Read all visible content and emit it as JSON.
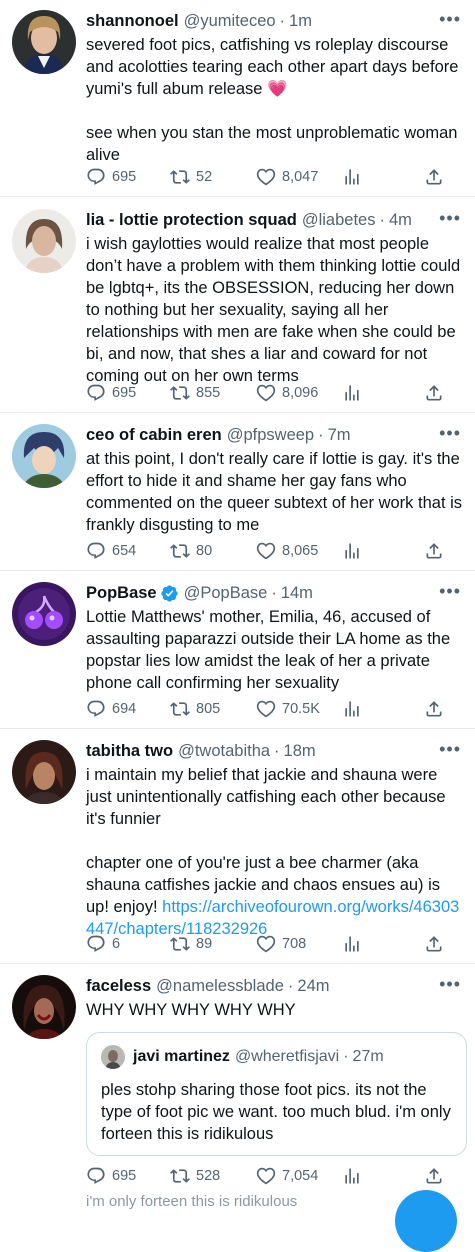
{
  "colors": {
    "accent": "#1d9bf0",
    "muted": "#536471",
    "divider": "#e6ecf0"
  },
  "tweets": [
    {
      "name": "shannonoel",
      "handle": "@yumiteceo",
      "time": "1m",
      "text": "severed foot pics, catfishing vs roleplay discourse and acolotties tearing each other apart days before yumi's full abum release 💗\n\nsee when you stan the most unproblematic woman alive",
      "replies": "695",
      "retweets": "52",
      "likes": "8,047"
    },
    {
      "name": "lia - lottie protection squad",
      "handle": "@liabetes",
      "time": "4m",
      "text": "i wish gaylotties would realize that most people don’t have a problem with them thinking lottie could be lgbtq+, its the OBSESSION, reducing her down to nothing but her sexuality, saying all her relationships with men are fake when she could be bi, and now, that shes a liar and coward for not coming out on her own terms",
      "replies": "695",
      "retweets": "855",
      "likes": "8,096"
    },
    {
      "name": "ceo of cabin eren",
      "handle": "@pfpsweep",
      "time": "7m",
      "text": "at this point, I don't really care if lottie is gay. it's the effort to hide it and shame her gay fans who commented on the queer subtext of her work that is frankly disgusting to me",
      "replies": "654",
      "retweets": "80",
      "likes": "8,065"
    },
    {
      "name": "PopBase",
      "handle": "@PopBase",
      "time": "14m",
      "verified": true,
      "text": "Lottie Matthews' mother, Emilia, 46, accused of assaulting paparazzi outside their LA home as the popstar lies low amidst the leak of her a private phone call confirming her sexuality",
      "replies": "694",
      "retweets": "805",
      "likes": "70.5K"
    },
    {
      "name": "tabitha two",
      "handle": "@twotabitha",
      "time": "18m",
      "text": "i maintain my belief that jackie and shauna were just unintentionally catfishing each other because it's funnier\n\nchapter one of you're just a bee charmer (aka shauna catfishes jackie and chaos ensues au) is up! enjoy! ",
      "link": "https://archiveofourown.org/works/46303447/chapters/118232926",
      "replies": "6",
      "retweets": "89",
      "likes": "708"
    },
    {
      "name": "faceless",
      "handle": "@namelessblade",
      "time": "24m",
      "text": "WHY WHY WHY WHY WHY",
      "replies": "695",
      "retweets": "528",
      "likes": "7,054",
      "quote": {
        "name": "javi martinez",
        "handle": "@wheretfisjavi",
        "time": "27m",
        "text": "ples stohp sharing those foot pics. its not the type of foot pic we want. too much blud. i'm only forteen this is ridikulous"
      }
    }
  ],
  "bleed_text": "i'm only forteen this is ridikulous",
  "icons": {
    "reply": "reply-icon",
    "retweet": "retweet-icon",
    "like": "heart-icon",
    "stats": "stats-icon",
    "share": "share-icon",
    "more": "more-icon",
    "verified": "verified-badge-icon"
  }
}
